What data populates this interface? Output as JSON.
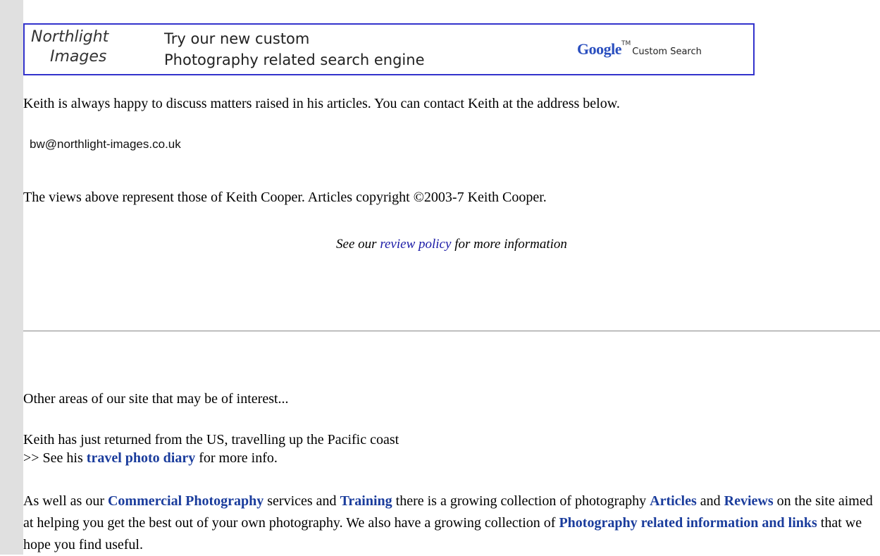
{
  "banner": {
    "logo_line1": "Northlight",
    "logo_line2": "Images",
    "tagline1": "Try our new custom",
    "tagline2": "Photography related search engine",
    "google_word": "Google",
    "google_tm": "TM",
    "custom_search": "Custom Search"
  },
  "contact": {
    "intro": "Keith is always happy to discuss matters raised in his articles. You can contact Keith at the address below.",
    "email": "bw@northlight-images.co.uk"
  },
  "copyright": "The views above represent those of Keith Cooper. Articles copyright ©2003-7 Keith Cooper.",
  "policy": {
    "pre": "See our ",
    "link": "review policy",
    "post": " for more information"
  },
  "other": {
    "heading": "Other areas of our site that may be of interest...",
    "travel_line1": "Keith has just returned from the US, travelling up the Pacific coast",
    "travel_pre": ">> See his ",
    "travel_link": "travel photo diary",
    "travel_post": " for more info.",
    "p_as_well": "As well as our ",
    "link_commercial": "Commercial Photography",
    "p_services": " services and ",
    "link_training": "Training",
    "p_growing": " there is a growing collection of photography ",
    "link_articles": "Articles",
    "p_and": " and ",
    "link_reviews": "Reviews",
    "p_site": " on the site aimed at helping you get the best out of your own photography. We also have a growing collection of ",
    "link_info": "Photography related information and links",
    "p_end": " that we hope you find useful."
  }
}
